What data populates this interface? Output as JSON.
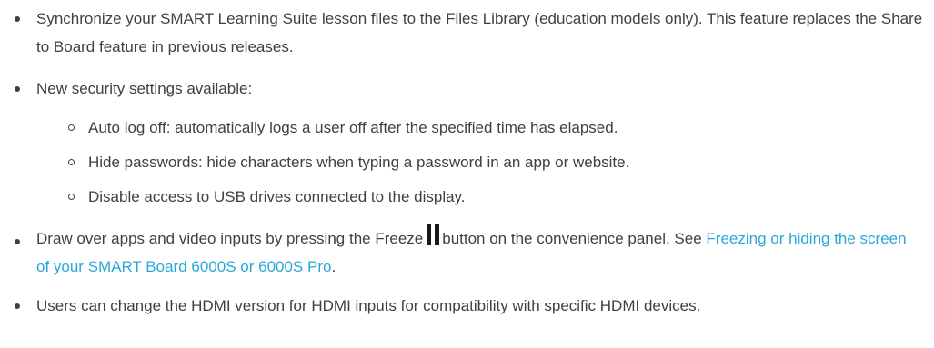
{
  "items": [
    {
      "text": "Synchronize your SMART Learning Suite lesson files to the Files Library (education models only). This feature replaces the Share to Board feature in previous releases."
    },
    {
      "text": "New security settings available:",
      "sub": [
        "Auto log off: automatically logs a user off after the specified time has elapsed.",
        "Hide passwords: hide characters when typing a password in an app or website.",
        "Disable access to USB drives connected to the display."
      ]
    },
    {
      "before_icon": "Draw over apps and video inputs by pressing the Freeze",
      "icon": "pause-icon",
      "after_icon": "button on the convenience panel. See ",
      "link": "Freezing or hiding the screen of your SMART Board 6000S or 6000S Pro",
      "after_link": "."
    },
    {
      "text": "Users can change the HDMI version for HDMI inputs for compatibility with specific HDMI devices."
    }
  ],
  "colors": {
    "text": "#404040",
    "link": "#2aa7d8",
    "icon": "#1a1a1a"
  }
}
